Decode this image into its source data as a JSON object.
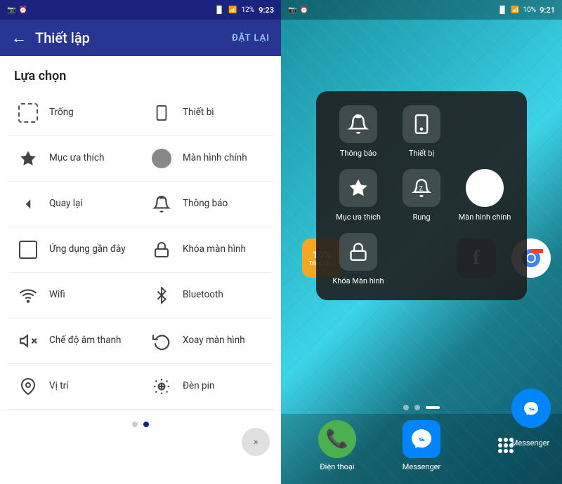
{
  "left": {
    "status_bar": {
      "left_icons": "📷 ⏰",
      "battery": "12%",
      "time": "9:23"
    },
    "top_bar": {
      "back_icon": "←",
      "title": "Thiết lập",
      "action": "ĐẶT LẠI"
    },
    "section_title": "Lựa chọn",
    "menu_items": [
      {
        "id": "trong",
        "label": "Trống",
        "icon": "dashed"
      },
      {
        "id": "thiet-bi",
        "label": "Thiết bị",
        "icon": "phone"
      },
      {
        "id": "muc-ua-thich",
        "label": "Mục ưa thích",
        "icon": "star"
      },
      {
        "id": "man-hinh-chinh",
        "label": "Màn hình chính",
        "icon": "circle"
      },
      {
        "id": "quay-lai",
        "label": "Quay lại",
        "icon": "back"
      },
      {
        "id": "thong-bao",
        "label": "Thông báo",
        "icon": "notification"
      },
      {
        "id": "ung-dung-gan-day",
        "label": "Ứng dụng gần đây",
        "icon": "square"
      },
      {
        "id": "khoa-man-hinh",
        "label": "Khóa màn hình",
        "icon": "lock"
      },
      {
        "id": "wifi",
        "label": "Wifi",
        "icon": "wifi"
      },
      {
        "id": "bluetooth",
        "label": "Bluetooth",
        "icon": "bluetooth"
      },
      {
        "id": "che-do-am-thanh",
        "label": "Chế độ âm thanh",
        "icon": "silent"
      },
      {
        "id": "xoay-man-hinh",
        "label": "Xoay màn hình",
        "icon": "rotate"
      },
      {
        "id": "vi-tri",
        "label": "Vị trí",
        "icon": "location"
      },
      {
        "id": "den-pin",
        "label": "Đèn pin",
        "icon": "flashlight"
      }
    ],
    "bottom_dots": [
      "inactive",
      "active"
    ],
    "scroll_label": ">>"
  },
  "right": {
    "status_bar": {
      "left_icons": "📷 ⏰",
      "battery": "10%",
      "time": "9:21"
    },
    "quick_menu": {
      "items": [
        {
          "id": "thong-bao-qm",
          "label": "Thông báo",
          "icon": "notification"
        },
        {
          "id": "thiet-bi-qm",
          "label": "Thiết bị",
          "icon": "phone"
        },
        {
          "id": "muc-ua-thich-qm",
          "label": "Mục ưa thích",
          "icon": "star"
        },
        {
          "id": "rung-qm",
          "label": "Rung",
          "icon": "bell"
        },
        {
          "id": "man-hinh-chinh-qm",
          "label": "Màn hình chính",
          "icon": "circle-white"
        },
        {
          "id": "khoa-man-hinh-qm",
          "label": "Khóa Màn hình",
          "icon": "lock"
        }
      ]
    },
    "dock": [
      {
        "id": "dien-thoai",
        "label": "Điện thoại",
        "icon": "📞",
        "bg": "#4caf50"
      },
      {
        "id": "messenger",
        "label": "Messenger",
        "icon": "💬",
        "bg": "#0084ff"
      },
      {
        "id": "apps",
        "label": "",
        "icon": "⠿",
        "bg": "transparent"
      }
    ],
    "messenger_corner_label": "Messenger",
    "right_dots": [
      "dot",
      "dot",
      "dash"
    ]
  }
}
